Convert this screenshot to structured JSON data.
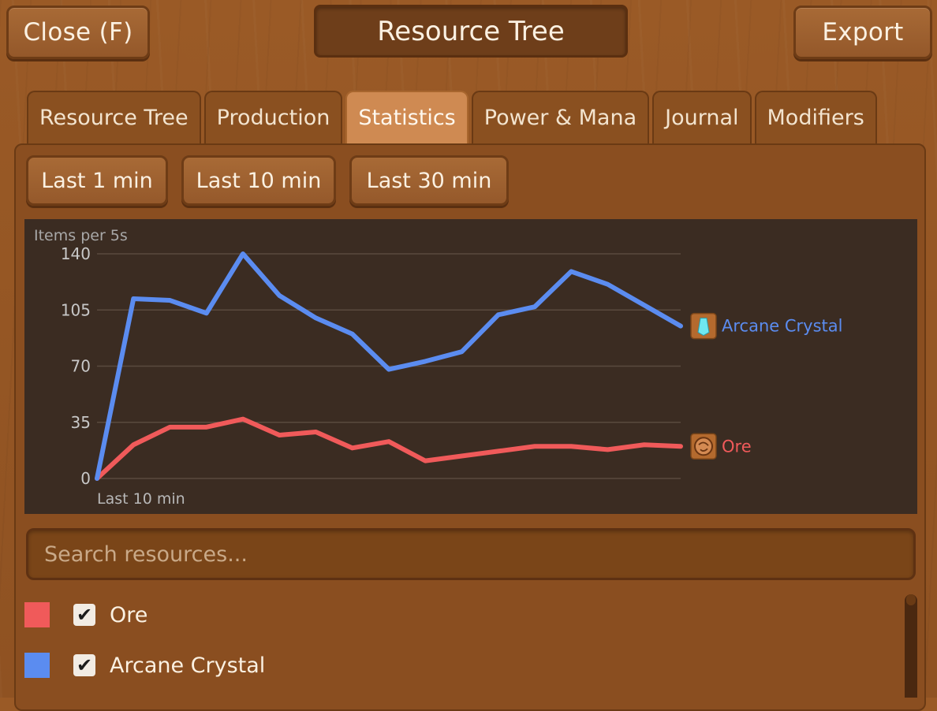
{
  "header": {
    "close_label": "Close (F)",
    "title": "Resource Tree",
    "export_label": "Export"
  },
  "tabs": [
    {
      "label": "Resource Tree",
      "active": false
    },
    {
      "label": "Production",
      "active": false
    },
    {
      "label": "Statistics",
      "active": true
    },
    {
      "label": "Power & Mana",
      "active": false
    },
    {
      "label": "Journal",
      "active": false
    },
    {
      "label": "Modifiers",
      "active": false
    }
  ],
  "ranges": {
    "last1": "Last 1 min",
    "last10": "Last 10 min",
    "last30": "Last 30 min"
  },
  "search": {
    "placeholder": "Search resources..."
  },
  "legend": [
    {
      "name": "Ore",
      "color": "#f05a5a",
      "checked": true
    },
    {
      "name": "Arcane Crystal",
      "color": "#5b8cf0",
      "checked": true
    }
  ],
  "chart_data": {
    "type": "line",
    "title": "",
    "ylabel": "Items per 5s",
    "xlabel": "Last 10 min",
    "ylim": [
      0,
      140
    ],
    "yticks": [
      0,
      35,
      70,
      105,
      140
    ],
    "grid": true,
    "series": [
      {
        "name": "Arcane Crystal",
        "color": "#5b8cf0",
        "icon": "crystal-icon",
        "values": [
          0,
          112,
          111,
          103,
          140,
          114,
          100,
          90,
          68,
          73,
          79,
          102,
          107,
          129,
          121,
          108,
          95
        ]
      },
      {
        "name": "Ore",
        "color": "#f05a5a",
        "icon": "ore-icon",
        "values": [
          0,
          21,
          32,
          32,
          37,
          27,
          29,
          19,
          23,
          11,
          14,
          17,
          20,
          20,
          18,
          21,
          20
        ]
      }
    ]
  }
}
